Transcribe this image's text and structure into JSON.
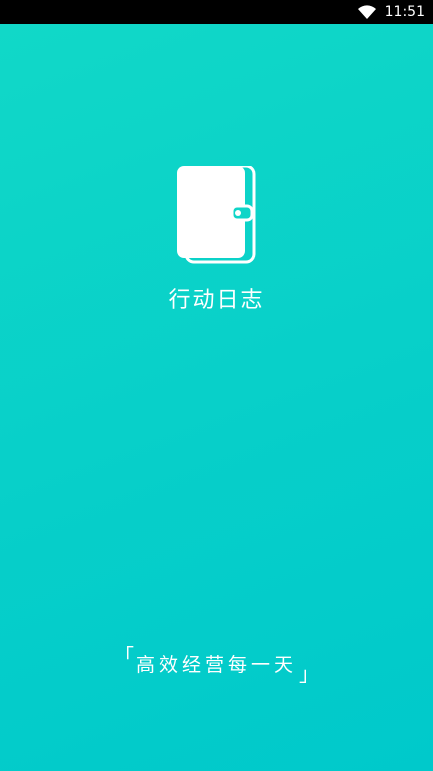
{
  "status_bar": {
    "time": "11:51",
    "wifi_icon": "wifi-icon"
  },
  "splash": {
    "app_name": "行动日志",
    "logo_icon": "notebook-icon",
    "slogan": "高效经营每一天",
    "slogan_open_bracket": "「",
    "slogan_close_bracket": "」"
  },
  "colors": {
    "background_start": "#11d8c8",
    "background_end": "#00c9cb",
    "foreground": "#ffffff"
  }
}
